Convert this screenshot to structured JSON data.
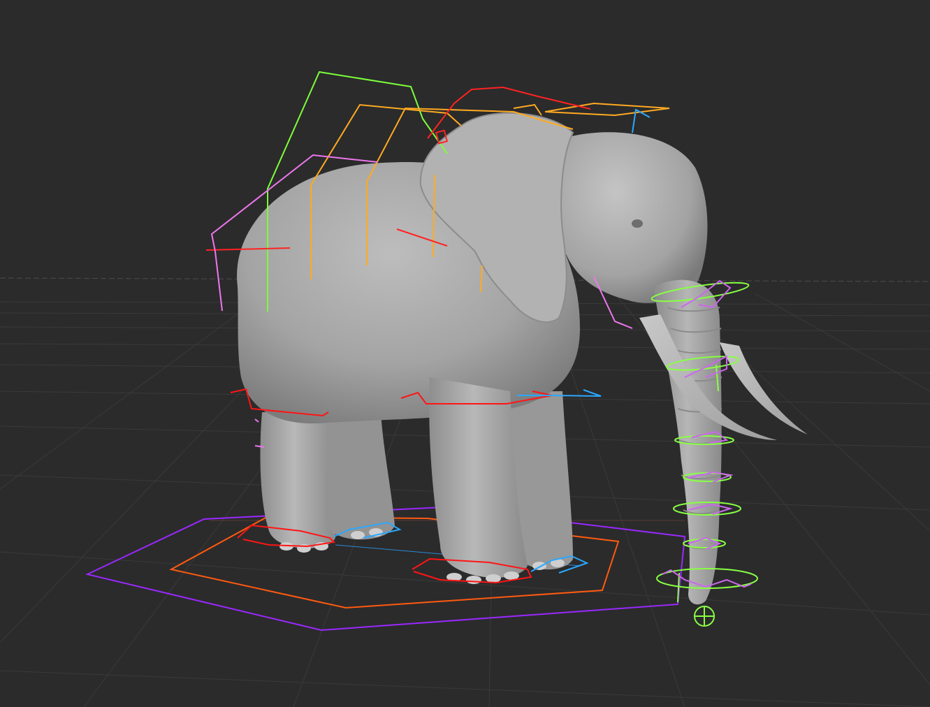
{
  "viewport": {
    "background": "#2b2b2b",
    "grid_color": "#3a3a3a",
    "horizon_color": "#4a4a4a",
    "model_color": "#a9a9a9"
  },
  "rig_colors": {
    "spine": "#7cff3a",
    "back_arc": "#ffaa22",
    "ear_arc": "#ff2222",
    "side_arc": "#ee77ee",
    "trunk_rings": "#88ff44",
    "trunk_aux": "#cc66ee",
    "ground_outer": "#9a28ff",
    "ground_inner": "#ff5a10",
    "foot_red": "#ff1515",
    "foot_blue": "#2aa8ff"
  }
}
